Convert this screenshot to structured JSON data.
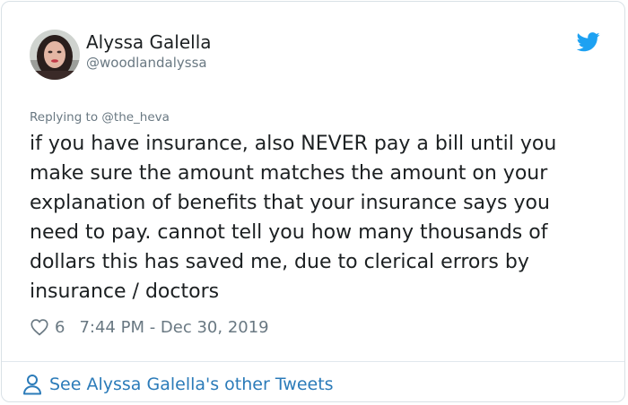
{
  "author": {
    "display_name": "Alyssa Galella",
    "handle": "@woodlandalyssa"
  },
  "reply": {
    "prefix": "Replying to ",
    "mention": "@the_heva"
  },
  "tweet": {
    "text": "if you have insurance, also NEVER pay a bill until you make sure the amount matches the amount on your explanation of benefits that your insurance says you need to pay. cannot tell you how many thousands of dollars this has saved me, due to clerical errors by insurance / doctors"
  },
  "meta": {
    "like_count": "6",
    "timestamp": "7:44 PM - Dec 30, 2019"
  },
  "footer": {
    "link_label": "See Alyssa Galella's other Tweets"
  },
  "icons": {
    "brand": "twitter-bird-icon",
    "like": "heart-icon",
    "profile": "person-icon"
  },
  "colors": {
    "brand_blue": "#1da1f2",
    "link_blue": "#2b7bb9",
    "text_primary": "#1c2022",
    "text_secondary": "#697882",
    "border": "#d9e1e6"
  }
}
